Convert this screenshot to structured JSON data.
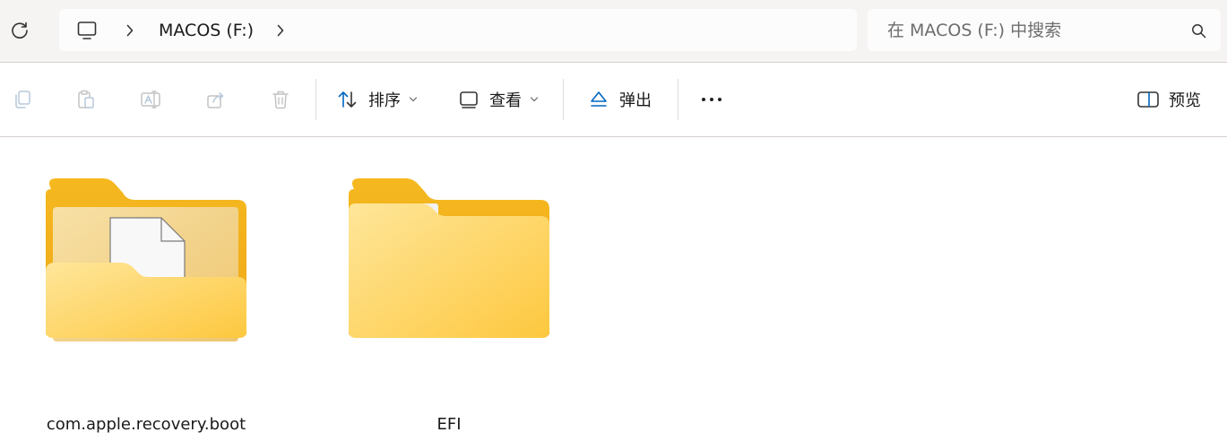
{
  "address": {
    "refresh_icon": "refresh-icon",
    "pc_icon": "this-pc-icon",
    "breadcrumb_label": "MACOS (F:)"
  },
  "search": {
    "placeholder": "在 MACOS (F:) 中搜索"
  },
  "toolbar": {
    "sort_label": "排序",
    "view_label": "查看",
    "eject_label": "弹出",
    "preview_label": "预览",
    "accent_color": "#0067c0"
  },
  "files": [
    {
      "name": "com.apple.recovery.boot",
      "type": "folder-with-file"
    },
    {
      "name": "EFI",
      "type": "folder"
    }
  ]
}
